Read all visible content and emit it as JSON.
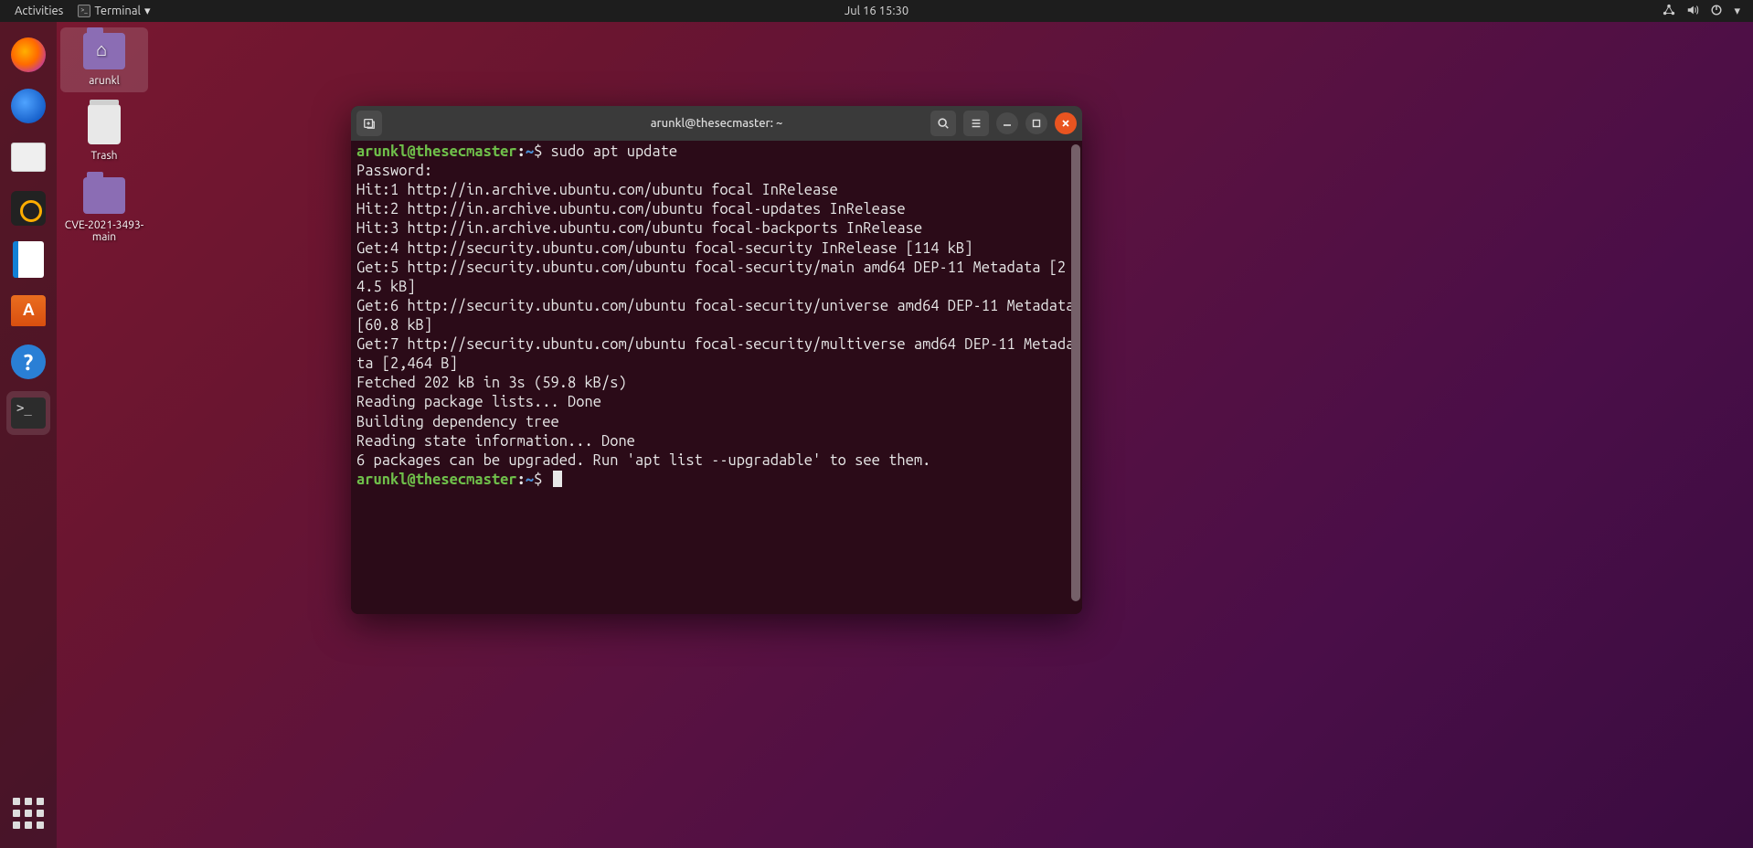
{
  "top_panel": {
    "activities": "Activities",
    "app_label": "Terminal",
    "datetime": "Jul 16  15:30"
  },
  "desktop": {
    "home_label": "arunkl",
    "trash_label": "Trash",
    "folder_label": "CVE-2021-3493-main"
  },
  "terminal": {
    "title": "arunkl@thesecmaster: ~",
    "prompt_user": "arunkl@thesecmaster",
    "prompt_path": "~",
    "command": "sudo apt update",
    "lines": [
      "Password:",
      "Hit:1 http://in.archive.ubuntu.com/ubuntu focal InRelease",
      "Hit:2 http://in.archive.ubuntu.com/ubuntu focal-updates InRelease",
      "Hit:3 http://in.archive.ubuntu.com/ubuntu focal-backports InRelease",
      "Get:4 http://security.ubuntu.com/ubuntu focal-security InRelease [114 kB]",
      "Get:5 http://security.ubuntu.com/ubuntu focal-security/main amd64 DEP-11 Metadata [24.5 kB]",
      "Get:6 http://security.ubuntu.com/ubuntu focal-security/universe amd64 DEP-11 Metadata [60.8 kB]",
      "Get:7 http://security.ubuntu.com/ubuntu focal-security/multiverse amd64 DEP-11 Metadata [2,464 B]",
      "Fetched 202 kB in 3s (59.8 kB/s)",
      "Reading package lists... Done",
      "Building dependency tree",
      "Reading state information... Done",
      "6 packages can be upgraded. Run 'apt list --upgradable' to see them."
    ]
  }
}
